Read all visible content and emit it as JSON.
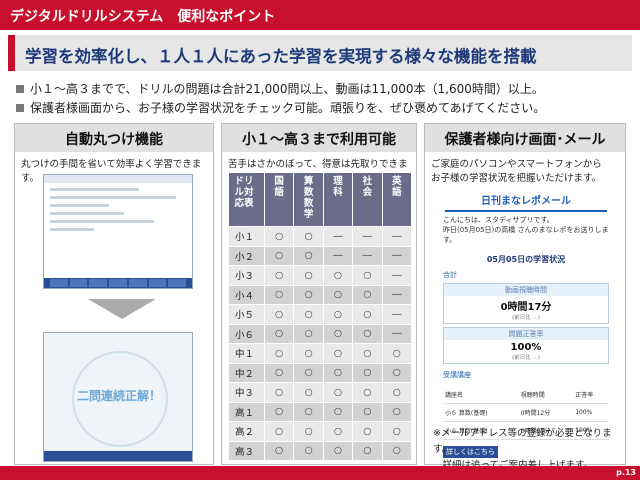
{
  "header": {
    "title": "デジタルドリルシステム　便利なポイント"
  },
  "headline": "学習を効率化し、１人１人にあった学習を実現する様々な機能を搭載",
  "bullets": [
    "小１～高３までで、ドリルの問題は合計21,000問以上、動画は11,000本（1,600時間）以上。",
    "保護者様画面から、お子様の学習状況をチェック可能。頑張りを、ぜひ褒めてあげてください。"
  ],
  "panel1": {
    "title": "自動丸つけ機能",
    "desc": "丸つけの手間を省いて効率よく学習できます。",
    "screen_text": "二問連続正解！"
  },
  "panel2": {
    "title": "小１～高３まで利用可能",
    "desc": "苦手はさかのぼって、得意は先取りできます。",
    "headers": [
      "ドリル対応表",
      "国語",
      "算数数学",
      "理科",
      "社会",
      "英語"
    ],
    "rows": [
      {
        "grade": "小１",
        "cells": [
          "○",
          "○",
          "―",
          "―",
          "―"
        ]
      },
      {
        "grade": "小２",
        "cells": [
          "○",
          "○",
          "―",
          "―",
          "―"
        ]
      },
      {
        "grade": "小３",
        "cells": [
          "○",
          "○",
          "○",
          "○",
          "―"
        ]
      },
      {
        "grade": "小４",
        "cells": [
          "○",
          "○",
          "○",
          "○",
          "―"
        ]
      },
      {
        "grade": "小５",
        "cells": [
          "○",
          "○",
          "○",
          "○",
          "―"
        ]
      },
      {
        "grade": "小６",
        "cells": [
          "○",
          "○",
          "○",
          "○",
          "―"
        ]
      },
      {
        "grade": "中１",
        "cells": [
          "○",
          "○",
          "○",
          "○",
          "○"
        ]
      },
      {
        "grade": "中２",
        "cells": [
          "○",
          "○",
          "○",
          "○",
          "○"
        ]
      },
      {
        "grade": "中３",
        "cells": [
          "○",
          "○",
          "○",
          "○",
          "○"
        ]
      },
      {
        "grade": "高１",
        "cells": [
          "○",
          "○",
          "○",
          "○",
          "○"
        ]
      },
      {
        "grade": "高２",
        "cells": [
          "○",
          "○",
          "○",
          "○",
          "○"
        ]
      },
      {
        "grade": "高３",
        "cells": [
          "○",
          "○",
          "○",
          "○",
          "○"
        ]
      }
    ]
  },
  "panel3": {
    "title": "保護者様向け画面･メール",
    "desc1": "ご家庭のパソコンやスマートフォンから",
    "desc2": "お子様の学習状況を把握いただけます。",
    "report": {
      "title": "日刊まなレポメール",
      "greet1": "こんにちは、スタディサプリです。",
      "greet2": "昨日(05月05日)の高橋 さんのまなレポをお送りします。",
      "date": "05月05日の学習状況",
      "total_label": "合計",
      "time_label": "動画視聴時間",
      "time_value": "0時間17分",
      "time_note": "(前日比 ...)",
      "rate_label": "問題正答率",
      "rate_value": "100%",
      "rate_note": "(前日比 ...)",
      "course_label": "受講講座",
      "col_name": "講座名",
      "col_time": "視聴時間",
      "col_rate": "正答率",
      "courses": [
        {
          "name": "小６ 算数(基礎)",
          "time": "0時間12分",
          "rate": "100%"
        },
        {
          "name": "小６ 算数(基礎)",
          "time": "0時間05分",
          "rate": "100%"
        }
      ],
      "link": "詳しくはこちら"
    },
    "note1": "※メールアドレス等の登録が必要となります。",
    "note2": "　詳細は追ってご案内差し上げます。"
  },
  "footer": {
    "page": "p.13"
  }
}
